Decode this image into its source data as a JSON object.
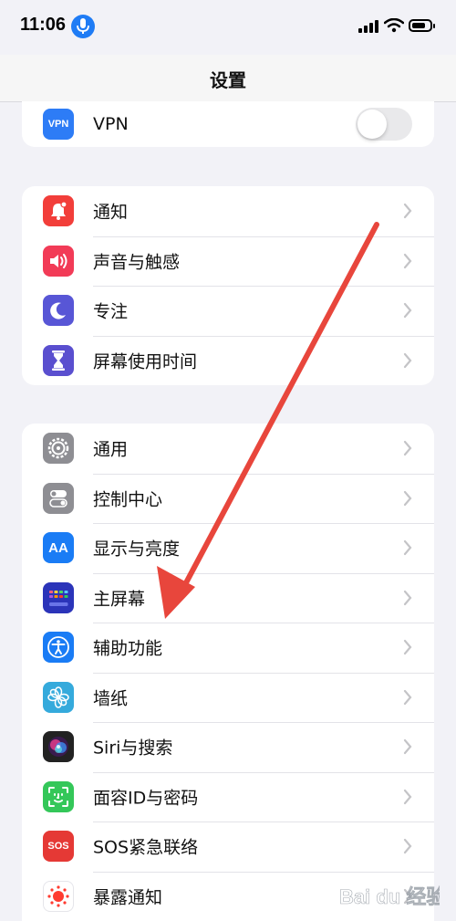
{
  "status_bar": {
    "time": "11:06"
  },
  "nav": {
    "title": "设置"
  },
  "groups": [
    {
      "rows": [
        {
          "label": "VPN",
          "icon": "vpn-icon",
          "icon_text": "VPN",
          "color": "#2d7cf6",
          "toggle_on": false
        }
      ]
    },
    {
      "rows": [
        {
          "label": "通知",
          "icon": "bell-icon",
          "color": "#f23e3a"
        },
        {
          "label": "声音与触感",
          "icon": "speaker-icon",
          "color": "#f23b57"
        },
        {
          "label": "专注",
          "icon": "moon-icon",
          "color": "#5856d6"
        },
        {
          "label": "屏幕使用时间",
          "icon": "hourglass-icon",
          "color": "#5a4fcf"
        }
      ]
    },
    {
      "rows": [
        {
          "label": "通用",
          "icon": "gear-icon",
          "color": "#8e8e93"
        },
        {
          "label": "控制中心",
          "icon": "switches-icon",
          "color": "#8e8e93"
        },
        {
          "label": "显示与亮度",
          "icon": "text-size-icon",
          "icon_text": "AA",
          "color": "#1a7cf5"
        },
        {
          "label": "主屏幕",
          "icon": "home-grid-icon",
          "color": "#2b34b9"
        },
        {
          "label": "辅助功能",
          "icon": "accessibility-icon",
          "color": "#1a7cf5"
        },
        {
          "label": "墙纸",
          "icon": "flower-icon",
          "color": "#35aadc"
        },
        {
          "label": "Siri与搜索",
          "icon": "siri-icon",
          "color": "#222"
        },
        {
          "label": "面容ID与密码",
          "icon": "face-id-icon",
          "color": "#34c759"
        },
        {
          "label": "SOS紧急联络",
          "icon": "sos-icon",
          "icon_text": "SOS",
          "color": "#e53935"
        },
        {
          "label": "暴露通知",
          "icon": "exposure-icon",
          "color": "#ffffff"
        }
      ]
    }
  ],
  "watermark": {
    "text": "Bai du 经验"
  },
  "colors": {
    "arrow": "#e8463c",
    "chevron": "#c4c4c7"
  }
}
